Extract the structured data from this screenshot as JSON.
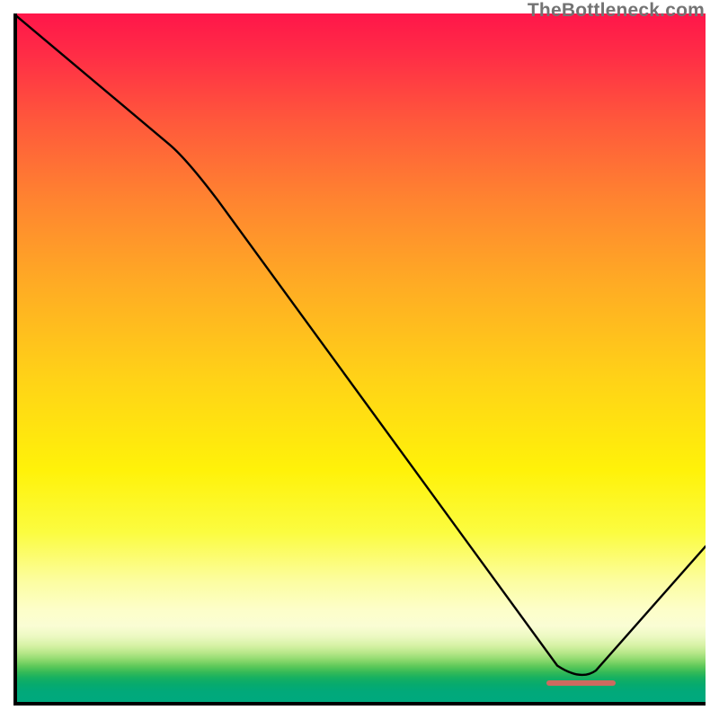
{
  "watermark": "TheBottleneck.com",
  "chart_data": {
    "type": "line",
    "title": "",
    "xlabel": "",
    "ylabel": "",
    "xlim": [
      0,
      100
    ],
    "ylim": [
      0,
      100
    ],
    "x": [
      0,
      25,
      82,
      100
    ],
    "values": [
      100,
      79,
      3.5,
      23
    ],
    "curve_note": "Piecewise near-linear curve: gentle decline 0→25, steep decline 25→82 (minimum), rise 82→100",
    "optimum_marker": {
      "x_start": 77,
      "x_end": 87,
      "y": 3.2,
      "color": "#ce6a5f"
    },
    "gradient_stops": [
      {
        "pct": 0,
        "color": "#ff164a"
      },
      {
        "pct": 16,
        "color": "#ff5a3b"
      },
      {
        "pct": 39,
        "color": "#ffab24"
      },
      {
        "pct": 66,
        "color": "#fff209"
      },
      {
        "pct": 82,
        "color": "#fcfda0"
      },
      {
        "pct": 90,
        "color": "#ecf9c2"
      },
      {
        "pct": 95,
        "color": "#34ba57"
      },
      {
        "pct": 100,
        "color": "#00a97f"
      }
    ]
  }
}
